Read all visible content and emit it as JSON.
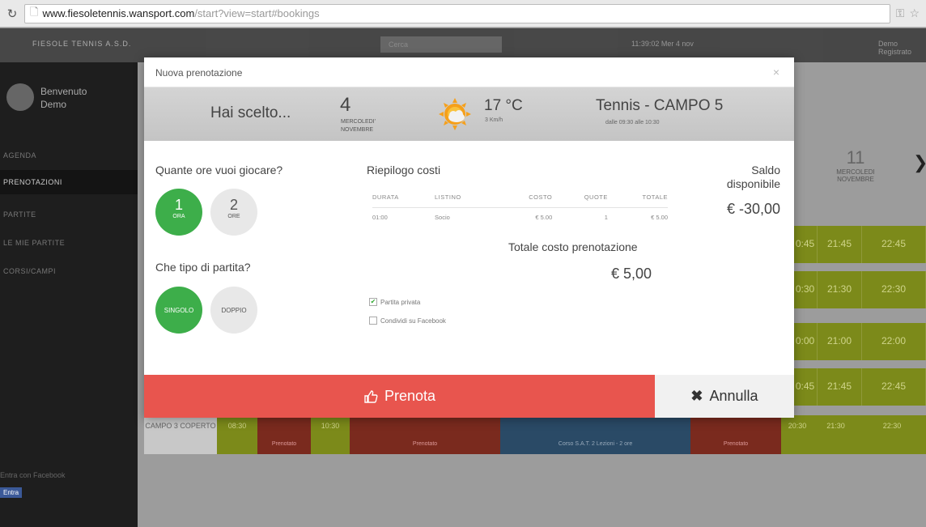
{
  "browser": {
    "url_host": "www.fiesoletennis.wansport.com",
    "url_path": "/start?view=start#bookings",
    "reload_icon": "reload-icon",
    "page_icon": "page-icon"
  },
  "app": {
    "brand": "FIESOLE TENNIS A.S.D.",
    "search_placeholder": "Cerca",
    "clock": "11:39:02 Mer 4 nov",
    "user": "Demo Registrato",
    "sidebar": {
      "welcome": "Benvenuto",
      "user_name": "Demo",
      "items": [
        "AGENDA",
        "PRENOTAZIONI",
        "PARTITE",
        "LE MIE PARTITE",
        "CORSI/CAMPI"
      ],
      "facebook": "Entra con Facebook",
      "facebook_btn": "Entra"
    },
    "background": {
      "date_day": "11",
      "date_name": "MERCOLEDI NOVEMBRE",
      "times_row1": [
        "0:45",
        "21:45",
        "22:45"
      ],
      "times_row2": [
        "0:30",
        "21:30",
        "22:30"
      ],
      "times_row3": [
        "0:00",
        "21:00",
        "22:00"
      ],
      "times_row4": [
        "0:45",
        "21:45",
        "22:45"
      ],
      "bottom_row": {
        "court": "CAMPO 3 COPERTO",
        "t1": "08:30",
        "t2": "10:30",
        "booked": "Prenotato",
        "course": "Corso S.A.T. 2 Lezioni - 2 ore",
        "t3": "20:30",
        "t4": "21:30",
        "t5": "22:30"
      }
    }
  },
  "modal": {
    "title": "Nuova prenotazione",
    "close": "×",
    "choice": {
      "hai_scelto": "Hai scelto...",
      "day_num": "4",
      "day_name": "MERCOLEDI'",
      "month": "NOVEMBRE",
      "temp": "17 °C",
      "wind": "3 Km/h",
      "court": "Tennis - CAMPO 5",
      "court_time": "dalle 09:30 alle 10:30"
    },
    "hours_question": "Quante ore vuoi giocare?",
    "hour_options": [
      {
        "n": "1",
        "unit": "ORA"
      },
      {
        "n": "2",
        "unit": "ORE"
      }
    ],
    "match_question": "Che tipo di partita?",
    "match_options": [
      "SINGOLO",
      "DOPPIO"
    ],
    "summary_title": "Riepilogo costi",
    "table": {
      "headers": [
        "DURATA",
        "LISTINO",
        "COSTO",
        "QUOTE",
        "TOTALE"
      ],
      "row": [
        "01:00",
        "Socio",
        "€ 5.00",
        "1",
        "€ 5.00"
      ]
    },
    "total_label": "Totale costo prenotazione",
    "total_value": "€ 5,00",
    "checks": [
      "Partita privata",
      "Condividi su Facebook"
    ],
    "balance_label": "Saldo disponibile",
    "balance_value": "€ -30,00",
    "prenota_label": "Prenota",
    "annulla_label": "Annulla"
  }
}
